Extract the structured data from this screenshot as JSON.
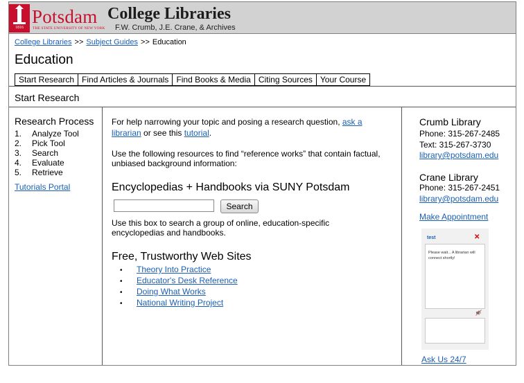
{
  "header": {
    "logo_word": "Potsdam",
    "logo_year": "1816",
    "logo_tagline": "THE STATE UNIVERSITY OF NEW YORK",
    "site_title": "College Libraries",
    "site_subtitle": "F.W. Crumb, J.E. Crane, & Archives",
    "brand_color": "#c8102e"
  },
  "breadcrumb": {
    "items": [
      "College Libraries",
      "Subject Guides",
      "Education"
    ],
    "separator": ">>"
  },
  "page_title": "Education",
  "tabs": [
    "Start Research",
    "Find Articles & Journals",
    "Find Books & Media",
    "Citing Sources",
    "Your Course"
  ],
  "section_label": "Start Research",
  "left": {
    "title": "Research Process",
    "steps": [
      {
        "num": "1.",
        "label": "Analyze Tool"
      },
      {
        "num": "2.",
        "label": "Pick Tool"
      },
      {
        "num": "3.",
        "label": "Search"
      },
      {
        "num": "4.",
        "label": "Evaluate"
      },
      {
        "num": "5.",
        "label": "Retrieve"
      }
    ],
    "tutorials_link": "Tutorials Portal"
  },
  "main": {
    "intro_before": "For help narrowing your topic and posing a research question, ",
    "intro_link1": "ask a librarian",
    "intro_middle": " or see this ",
    "intro_link2": "tutorial",
    "intro_after": ".",
    "resources_text": "Use the following resources to find “reference works” that contain factual, unbiased background information:",
    "encyclopedias_title": "Encyclopedias + Handbooks via SUNY Potsdam",
    "search_value": "",
    "search_button": "Search",
    "search_note": "Use this box to search a group of online, education-specific encyclopedias and handbooks.",
    "free_title": "Free, Trustworthy Web Sites",
    "bullet": "•",
    "free_links": [
      "Theory Into Practice",
      "Educator's Desk Reference",
      "Doing What Works",
      "National Writing Project"
    ]
  },
  "right": {
    "crumb": {
      "name": "Crumb Library",
      "phone": "Phone: 315-267-2485",
      "text": "Text: 315-267-3730",
      "email": "library@potsdam.edu"
    },
    "crane": {
      "name": "Crane Library",
      "phone": "Phone: 315-267-2451",
      "email": "library@potsdam.edu"
    },
    "appointment_link": "Make Appointment",
    "chat": {
      "title": "test",
      "message": "Please wait... A librarian will connect shortly!",
      "close_icon": "close-icon",
      "sound_icon": "speaker-icon"
    },
    "ask_link": "Ask Us 24/7"
  }
}
